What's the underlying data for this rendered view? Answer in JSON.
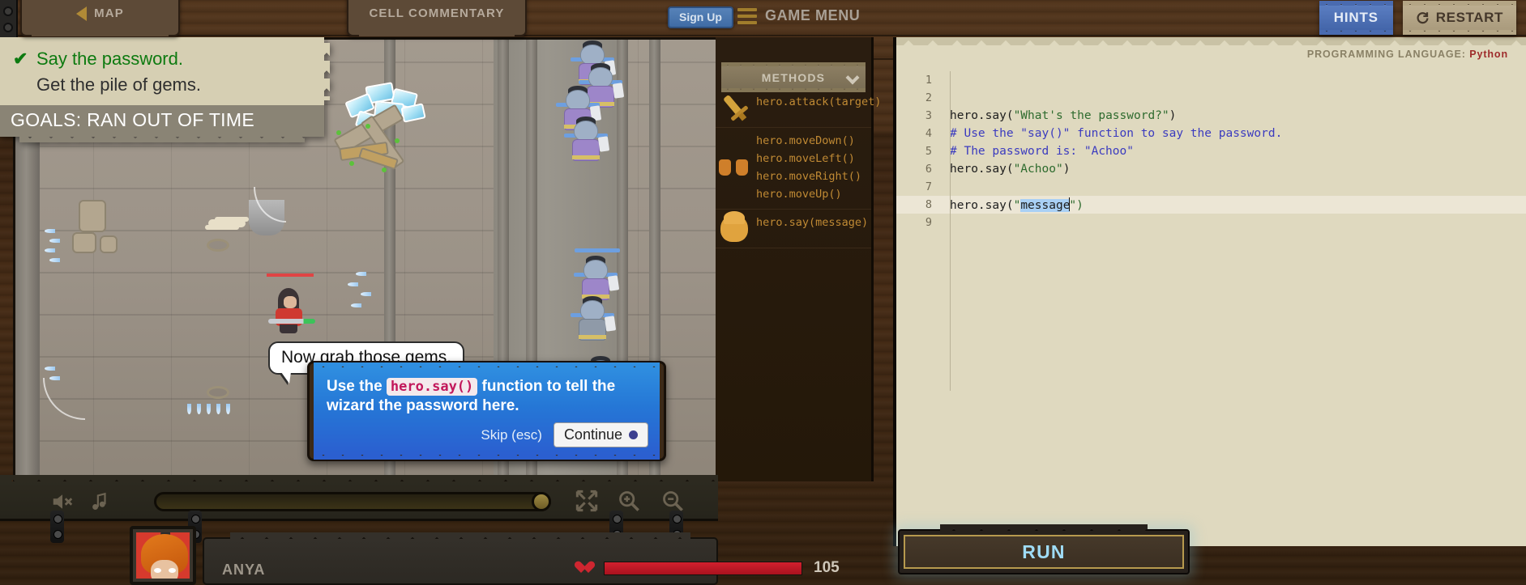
{
  "topbar": {
    "map_label": "MAP",
    "commentary_label": "CELL COMMENTARY",
    "signup_label": "Sign Up",
    "game_menu_label": "GAME MENU",
    "hints_label": "HINTS",
    "restart_label": "RESTART",
    "restart_icon": "refresh-icon",
    "map_icon": "triangle-left-icon",
    "menu_icon": "hamburger-icon"
  },
  "goals": {
    "items": [
      {
        "text": "Say the password.",
        "complete": true,
        "check": "✔"
      },
      {
        "text": "Get the pile of gems.",
        "complete": false,
        "check": ""
      }
    ],
    "status": "GOALS: RAN OUT OF TIME",
    "status_color": "#8a8475"
  },
  "stage": {
    "speech_bubble": "Now grab those gems."
  },
  "tutorial": {
    "text_before": "Use the ",
    "code_chip": "hero.say()",
    "text_after": " function to tell the wizard the password here.",
    "skip_label": "Skip (esc)",
    "continue_label": "Continue",
    "accent_color": "#2577d6"
  },
  "methods": {
    "header": "METHODS",
    "chevron_icon": "chevron-down-icon",
    "groups": [
      {
        "icon": "sword-icon",
        "items": [
          "hero.attack(target)"
        ]
      },
      {
        "icon": "boots-icon",
        "items": [
          "hero.moveDown()",
          "hero.moveLeft()",
          "hero.moveRight()",
          "hero.moveUp()"
        ]
      },
      {
        "icon": "hero-head-icon",
        "items": [
          "hero.say(message)"
        ]
      }
    ]
  },
  "editor": {
    "lang_prefix": "PROGRAMMING LANGUAGE:",
    "lang_value": "Python",
    "active_line": 8,
    "lines": [
      {
        "n": "1",
        "segments": []
      },
      {
        "n": "2",
        "segments": []
      },
      {
        "n": "3",
        "segments": [
          {
            "t": "hero.say(",
            "k": "plain"
          },
          {
            "t": "\"What's the password?\"",
            "k": "string"
          },
          {
            "t": ")",
            "k": "plain"
          }
        ]
      },
      {
        "n": "4",
        "segments": [
          {
            "t": "# Use the \"say()\" function to say the password.",
            "k": "comment"
          }
        ]
      },
      {
        "n": "5",
        "segments": [
          {
            "t": "# The password is: \"Achoo\"",
            "k": "comment"
          }
        ]
      },
      {
        "n": "6",
        "segments": [
          {
            "t": "hero.say(",
            "k": "plain"
          },
          {
            "t": "\"Achoo\"",
            "k": "string"
          },
          {
            "t": ")",
            "k": "plain"
          }
        ]
      },
      {
        "n": "7",
        "segments": []
      },
      {
        "n": "8",
        "segments": [
          {
            "t": "hero.say(",
            "k": "plain"
          },
          {
            "t": "\"",
            "k": "string"
          },
          {
            "t": "message",
            "k": "selected"
          },
          {
            "t": "\")",
            "k": "string"
          }
        ]
      },
      {
        "n": "9",
        "segments": []
      }
    ]
  },
  "run": {
    "label": "RUN"
  },
  "controls": {
    "mute_icon": "speaker-muted-icon",
    "music_icon": "music-note-icon",
    "fullscreen_icon": "fullscreen-icon",
    "zoom_in_icon": "magnifier-plus-icon",
    "zoom_out_icon": "magnifier-minus-icon",
    "scrubber_value": 100
  },
  "hud": {
    "name": "ANYA",
    "health_icon": "heart-icon",
    "health_value": "105",
    "health_percent": 100
  }
}
